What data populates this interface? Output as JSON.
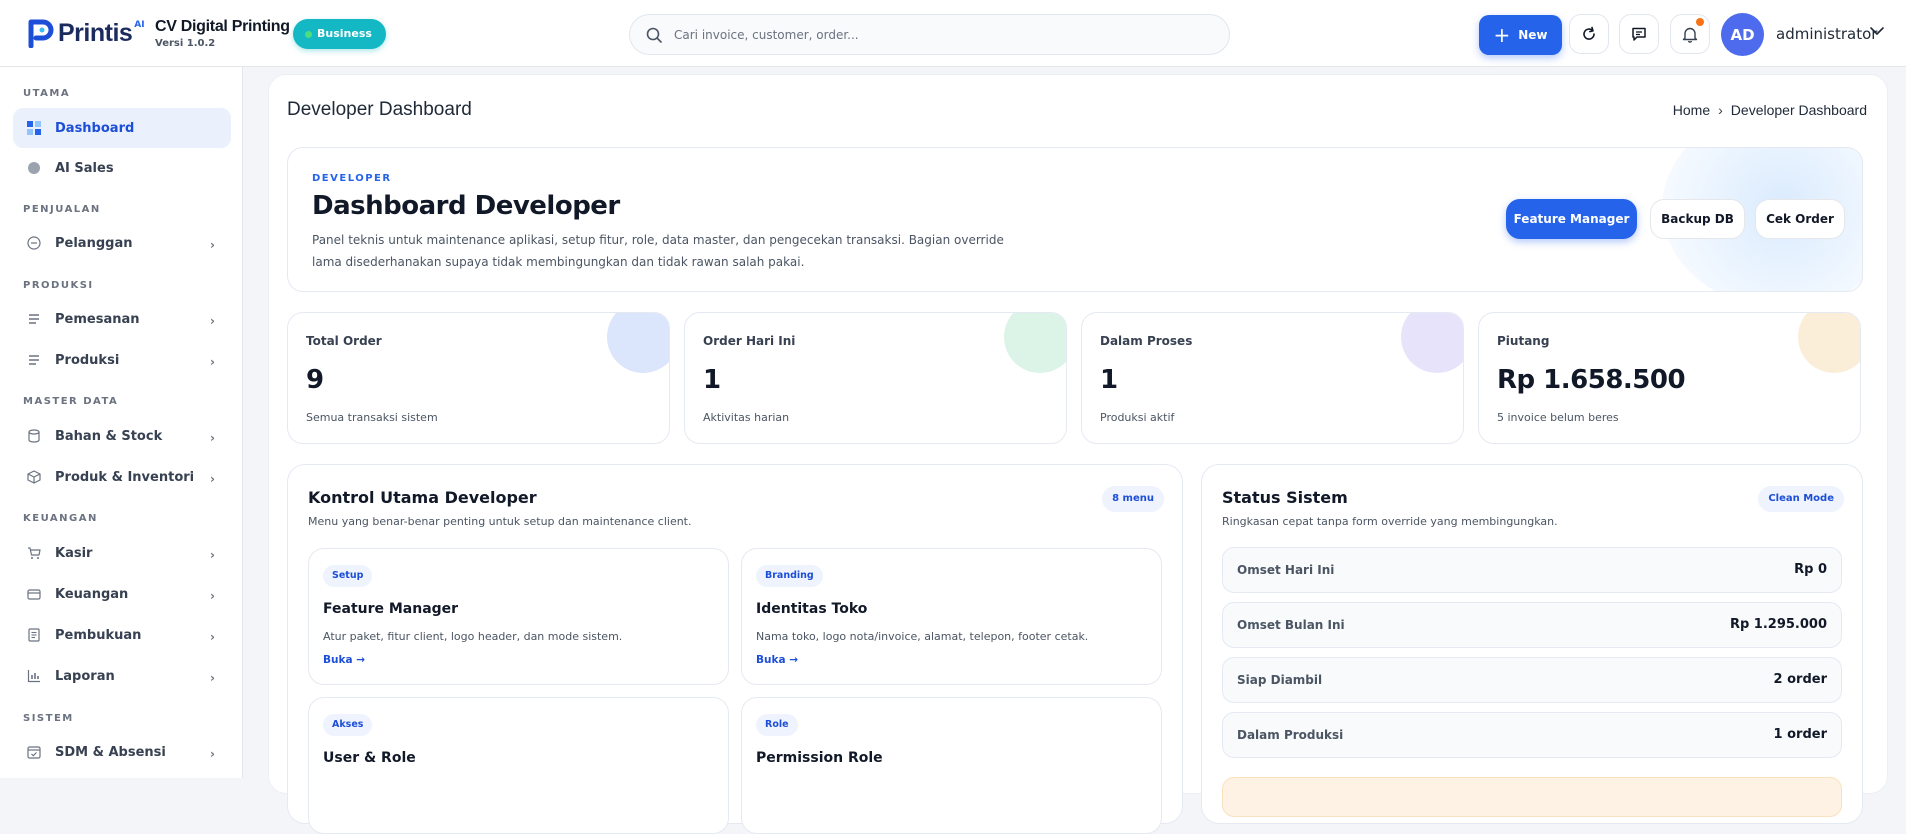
{
  "header": {
    "brand_name": "Printis",
    "brand_superscript": "AI",
    "company_name": "CV Digital Printing",
    "version": "Versi 1.0.2",
    "plan_badge": "Business",
    "search_placeholder": "Cari invoice, customer, order...",
    "new_button": "New",
    "avatar_initials": "AD",
    "username": "administrator"
  },
  "sidebar": {
    "sections": {
      "utama": "UTAMA",
      "penjualan": "PENJUALAN",
      "produksi": "PRODUKSI",
      "master_data": "MASTER DATA",
      "keuangan": "KEUANGAN",
      "sistem": "SISTEM"
    },
    "items": {
      "dashboard": "Dashboard",
      "ai_sales": "AI Sales",
      "pelanggan": "Pelanggan",
      "pemesanan": "Pemesanan",
      "produksi": "Produksi",
      "bahan_stock": "Bahan & Stock",
      "produk_inventori": "Produk & Inventori",
      "kasir": "Kasir",
      "keuangan": "Keuangan",
      "pembukuan": "Pembukuan",
      "laporan": "Laporan",
      "sdm_absensi": "SDM & Absensi"
    },
    "chevron": "›"
  },
  "page": {
    "title": "Developer Dashboard",
    "breadcrumb": [
      "Home",
      "Developer Dashboard"
    ],
    "breadcrumb_sep": "›"
  },
  "hero": {
    "eyebrow": "DEVELOPER",
    "title": "Dashboard Developer",
    "description": "Panel teknis untuk maintenance aplikasi, setup fitur, role, data master, dan pengecekan transaksi. Bagian override lama disederhanakan supaya tidak membingungkan dan tidak rawan salah pakai.",
    "buttons": [
      "Feature Manager",
      "Backup DB",
      "Cek Order"
    ]
  },
  "stats": [
    {
      "label": "Total Order",
      "value": "9",
      "sub": "Semua transaksi sistem",
      "color": "#dbe5fb"
    },
    {
      "label": "Order Hari Ini",
      "value": "1",
      "sub": "Aktivitas harian",
      "color": "#dcf3e7"
    },
    {
      "label": "Dalam Proses",
      "value": "1",
      "sub": "Produksi aktif",
      "color": "#e7e3fa"
    },
    {
      "label": "Piutang",
      "value": "Rp 1.658.500",
      "sub": "5 invoice belum beres",
      "color": "#fbeed9"
    }
  ],
  "kontrol": {
    "title": "Kontrol Utama Developer",
    "subtitle": "Menu yang benar-benar penting untuk setup dan maintenance client.",
    "badge": "8 menu",
    "cards": [
      {
        "tag": "Setup",
        "title": "Feature Manager",
        "desc": "Atur paket, fitur client, logo header, dan mode sistem.",
        "link": "Buka →"
      },
      {
        "tag": "Branding",
        "title": "Identitas Toko",
        "desc": "Nama toko, logo nota/invoice, alamat, telepon, footer cetak.",
        "link": "Buka →"
      },
      {
        "tag": "Akses",
        "title": "User & Role",
        "desc": "",
        "link": ""
      },
      {
        "tag": "Role",
        "title": "Permission Role",
        "desc": "",
        "link": ""
      }
    ]
  },
  "status_sistem": {
    "title": "Status Sistem",
    "subtitle": "Ringkasan cepat tanpa form override yang membingungkan.",
    "badge": "Clean Mode",
    "rows": [
      {
        "label": "Omset Hari Ini",
        "value": "Rp 0"
      },
      {
        "label": "Omset Bulan Ini",
        "value": "Rp 1.295.000"
      },
      {
        "label": "Siap Diambil",
        "value": "2 order"
      },
      {
        "label": "Dalam Produksi",
        "value": "1 order"
      }
    ]
  },
  "colors": {
    "accent": "#2563eb",
    "badge_teal": "#14b8c4",
    "notification": "#f97316",
    "avatar": "#4f6bed"
  }
}
